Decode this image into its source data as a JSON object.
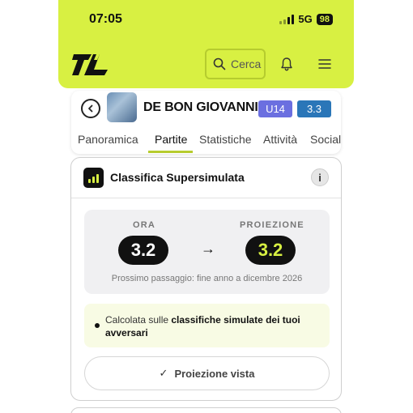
{
  "status_bar": {
    "time": "07:05",
    "network": "5G",
    "battery": "98"
  },
  "header": {
    "logo": "TL logo",
    "search_label": "Cerca",
    "icons": {
      "search": "search-icon",
      "bell": "bell-icon",
      "menu": "hamburger-menu-icon"
    },
    "accent": "#d8f042"
  },
  "profile": {
    "name": "DE BON GIOVANNI",
    "category_badge": "U14",
    "ranking_badge": "3.3",
    "category_color": "#6b6fe0",
    "ranking_color": "#2a76b8"
  },
  "tabs": [
    {
      "label": "Panoramica",
      "active": false
    },
    {
      "label": "Partite",
      "active": true
    },
    {
      "label": "Statistiche",
      "active": false
    },
    {
      "label": "Attività",
      "active": false
    },
    {
      "label": "Social",
      "active": false
    }
  ],
  "card": {
    "title": "Classifica Supersimulata",
    "info_label": "i",
    "now_label": "ORA",
    "now_value": "3.2",
    "arrow": "→",
    "projection_label": "PROIEZIONE",
    "projection_value": "3.2",
    "next_passage": "Prossimo passaggio: fine anno a dicembre 2026",
    "note_plain": "Calcolata sulle ",
    "note_bold": "classifiche simulate dei tuoi avversari",
    "seen_check": "✓",
    "seen_button": "Proiezione vista"
  }
}
